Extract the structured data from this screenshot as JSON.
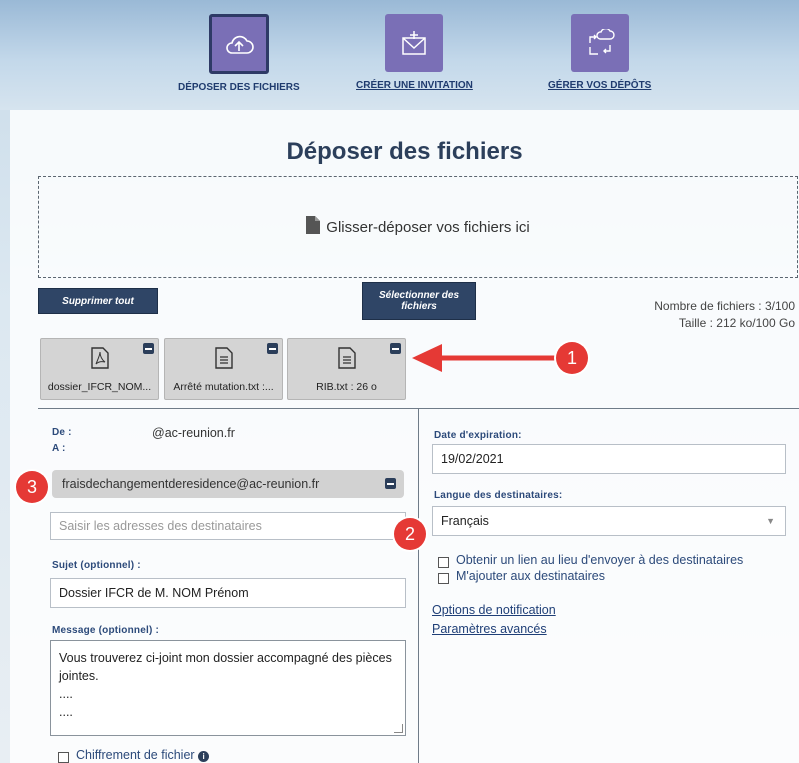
{
  "nav": {
    "items": [
      {
        "label": "DÉPOSER DES FICHIERS",
        "icon": "cloud-upload-icon",
        "active": true
      },
      {
        "label": "CRÉER UNE INVITATION",
        "icon": "envelope-plus-icon",
        "active": false
      },
      {
        "label": "GÉRER VOS DÉPÔTS",
        "icon": "transfer-icon",
        "active": false
      }
    ]
  },
  "page": {
    "title": "Déposer des fichiers",
    "dropzone_text": "Glisser-déposer vos fichiers ici",
    "delete_all": "Supprimer tout",
    "select_files": "Sélectionner des fichiers",
    "file_count": "Nombre de fichiers : 3/100",
    "size": "Taille : 212 ko/100 Go"
  },
  "files": [
    {
      "name": "dossier_IFCR_NOM...",
      "icon": "pdf-file-icon"
    },
    {
      "name": "Arrêté mutation.txt :...",
      "icon": "text-file-icon"
    },
    {
      "name": "RIB.txt : 26 o",
      "icon": "text-file-icon"
    }
  ],
  "form": {
    "from_label": "De :",
    "from_value": "@ac-reunion.fr",
    "to_label": "A :",
    "recipient": "fraisdechangementderesidence@ac-reunion.fr",
    "recipient_placeholder": "Saisir les adresses des destinataires",
    "subject_label": "Sujet (optionnel) :",
    "subject_value": "Dossier IFCR de M. NOM Prénom",
    "message_label": "Message (optionnel) :",
    "message_line1": "Vous trouverez ci-joint mon dossier accompagné des pièces",
    "message_line2": "jointes.",
    "message_line3": "....",
    "message_line4": "....",
    "encryption_label": "Chiffrement de fichier"
  },
  "options": {
    "expiration_label": "Date d'expiration:",
    "expiration_value": "19/02/2021",
    "language_label": "Langue des destinataires:",
    "language_value": "Français",
    "get_link_label": "Obtenir un lien au lieu d'envoyer à des destinataires",
    "add_me_label": "M'ajouter aux destinataires",
    "notification_link": "Options de notification",
    "advanced_link": "Paramètres avancés"
  },
  "annotations": [
    "1",
    "2",
    "3"
  ],
  "colors": {
    "accent": "#7a6fb6",
    "button": "#2f4566",
    "annotation": "#e53935"
  }
}
